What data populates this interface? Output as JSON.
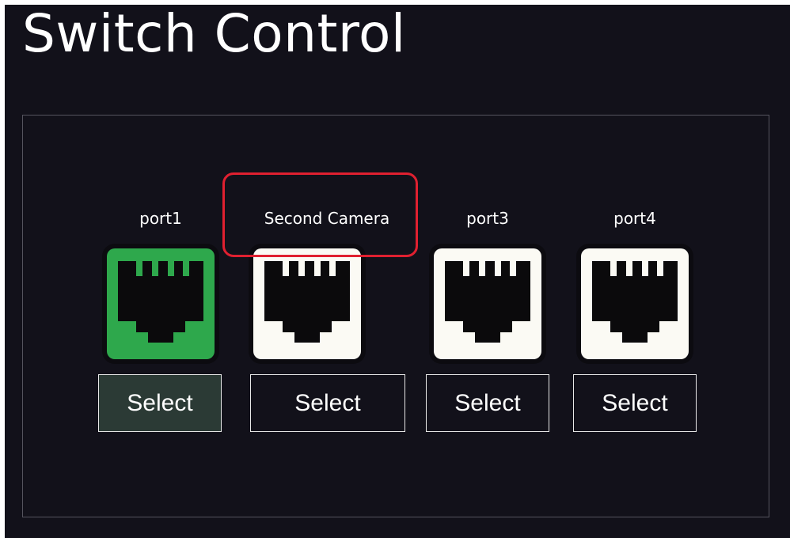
{
  "header": {
    "title": "Switch Control"
  },
  "colors": {
    "background": "#12111a",
    "active_port": "#2ea84c",
    "inactive_port": "#fbfaf4",
    "connector": "#0b0a0c",
    "active_button": "#2b3a35",
    "highlight": "#e02030"
  },
  "ports": [
    {
      "label": "port1",
      "button_label": "Select",
      "icon": "ethernet-port-icon",
      "state": "active"
    },
    {
      "label": "Second Camera",
      "button_label": "Select",
      "icon": "ethernet-port-icon",
      "state": "inactive",
      "highlighted": true
    },
    {
      "label": "port3",
      "button_label": "Select",
      "icon": "ethernet-port-icon",
      "state": "inactive"
    },
    {
      "label": "port4",
      "button_label": "Select",
      "icon": "ethernet-port-icon",
      "state": "inactive"
    }
  ]
}
